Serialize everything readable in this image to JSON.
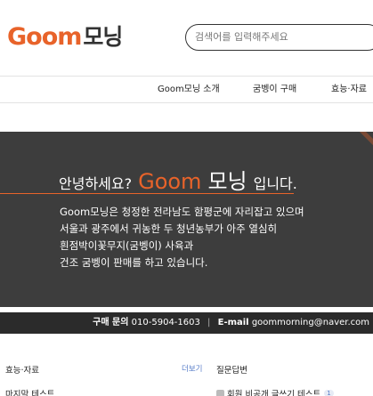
{
  "header": {
    "logo_brand": "Goom",
    "logo_korean": "모닝",
    "search_placeholder": "검색어를 입력해주세요"
  },
  "nav": {
    "items": [
      "Goom모닝 소개",
      "굼벵이 구매",
      "효능·자료"
    ]
  },
  "hero": {
    "greeting": "안녕하세요?",
    "brand": "Goom",
    "brand_ko": "모닝",
    "suffix": "입니다.",
    "lines": [
      "Goom모닝은 청정한 전라남도 함평군에 자리잡고 있으며",
      "서울과 광주에서 귀농한 두 청년농부가 아주 열심히",
      "흰점박이꽃무지(굼벵이) 사육과",
      "건조 굼벵이 판매를 하고 있습니다."
    ]
  },
  "contact": {
    "label": "구매 문의",
    "phone": "010-5904-1603",
    "email_label": "E-mail",
    "email": "goommorning@naver.com"
  },
  "bottom": {
    "left_title": "효능·자료",
    "left_more": "더보기",
    "left_item": "마지막 테스트",
    "right_title": "질문답변",
    "right_item": "회원 비공개 글쓰기 테스트",
    "right_badge": "1"
  },
  "colors": {
    "accent": "#e8632a",
    "hero_bg": "#3d3d3d",
    "contact_bg": "#2b2b2b"
  }
}
